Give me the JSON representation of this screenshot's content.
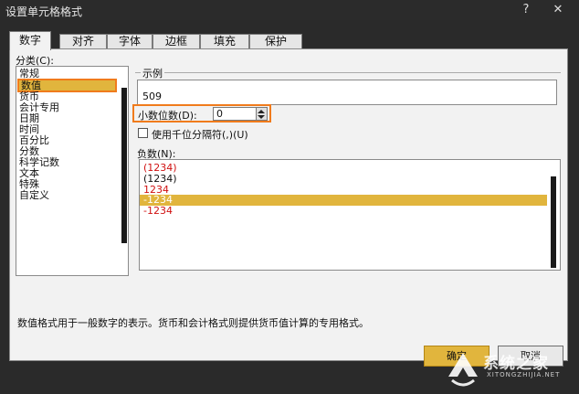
{
  "window": {
    "title": "设置单元格格式",
    "help_glyph": "?",
    "close_glyph": "✕"
  },
  "tabs": [
    {
      "label": "数字",
      "active": true
    },
    {
      "label": "对齐",
      "active": false
    },
    {
      "label": "字体",
      "active": false
    },
    {
      "label": "边框",
      "active": false
    },
    {
      "label": "填充",
      "active": false
    },
    {
      "label": "保护",
      "active": false
    }
  ],
  "category": {
    "label": "分类(C):",
    "items": [
      "常规",
      "数值",
      "货币",
      "会计专用",
      "日期",
      "时间",
      "百分比",
      "分数",
      "科学记数",
      "文本",
      "特殊",
      "自定义"
    ],
    "selected": "数值"
  },
  "sample": {
    "label": "示例",
    "value": "509"
  },
  "decimal": {
    "label": "小数位数(D):",
    "value": "0"
  },
  "thousands": {
    "label": "使用千位分隔符(,)(U)",
    "checked": false
  },
  "negative": {
    "label": "负数(N):",
    "items": [
      {
        "text": "(1234)",
        "color": "#d01010"
      },
      {
        "text": "(1234)",
        "color": "#111111"
      },
      {
        "text": "1234",
        "color": "#d01010"
      },
      {
        "text": "-1234",
        "color": "#ffffff"
      },
      {
        "text": "-1234",
        "color": "#d01010"
      }
    ],
    "selected_index": 3
  },
  "description": "数值格式用于一般数字的表示。货币和会计格式则提供货币值计算的专用格式。",
  "buttons": {
    "ok": "确定",
    "cancel": "取消"
  },
  "watermark": {
    "text": "系统之家",
    "sub": "XITONGZHIJIA.NET"
  },
  "colors": {
    "accent_highlight": "#e1b53d",
    "focus_outline": "#f07b1c",
    "title_bar": "#2b2b2b"
  }
}
